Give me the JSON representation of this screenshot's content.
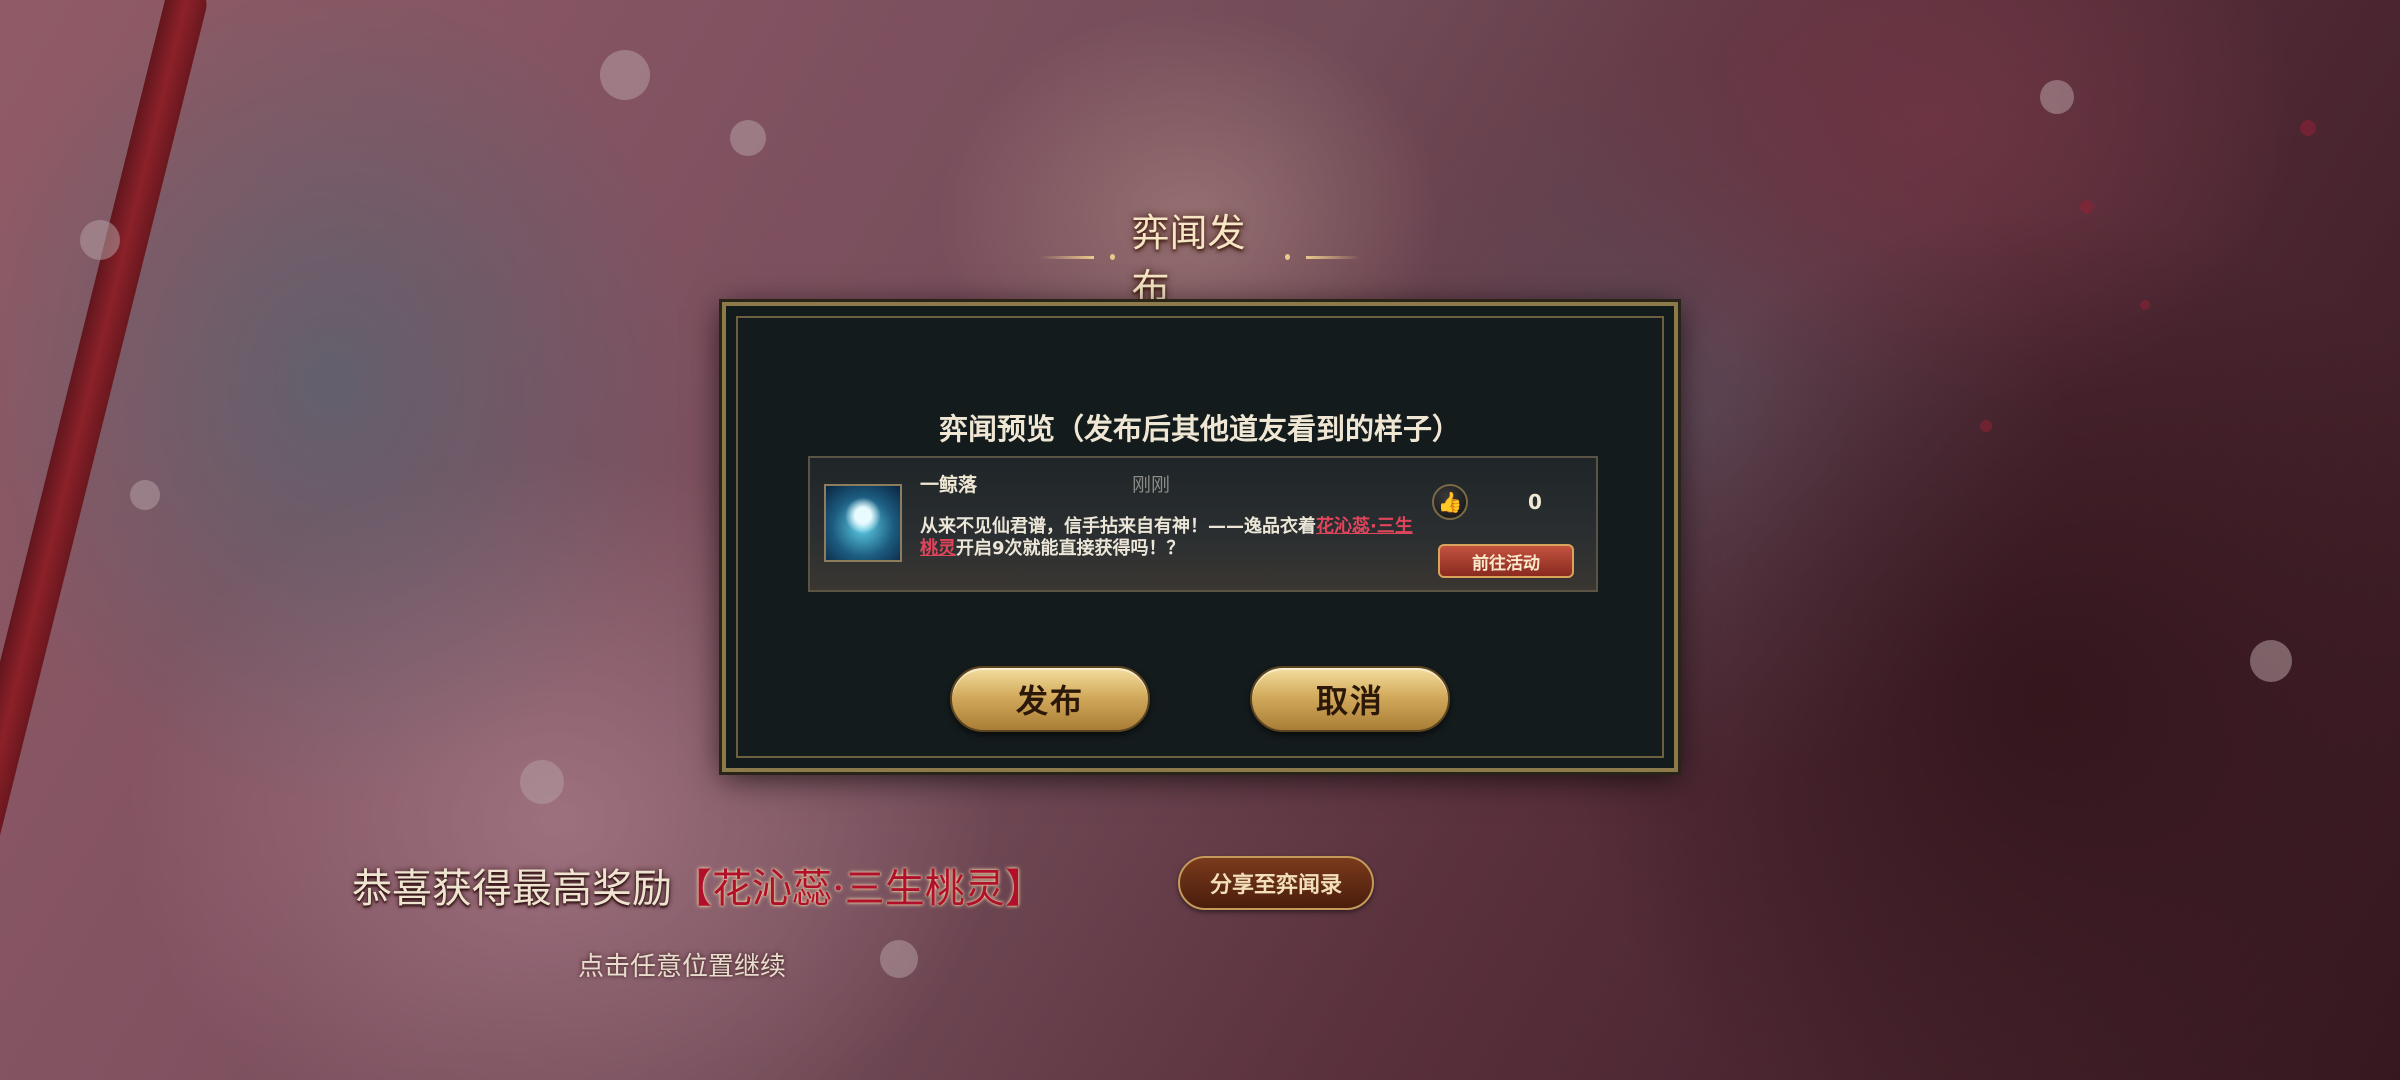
{
  "header": {
    "title": "弈闻发布"
  },
  "dialog": {
    "preview_title": "弈闻预览（发布后其他道友看到的样子）",
    "card": {
      "username": "一鲸落",
      "timestamp": "刚刚",
      "message_prefix": "从来不见仙君谱，信手拈来自有神！——逸品衣着",
      "message_highlight": "花沁蕊·三生桃灵",
      "message_suffix": "开启9次就能直接获得吗！？",
      "like_count": "0",
      "goto_button": "前往活动"
    },
    "publish_button": "发布",
    "cancel_button": "取消"
  },
  "reward": {
    "prefix": "恭喜获得最高奖励",
    "item": "【花沁蕊·三生桃灵】"
  },
  "share_button": "分享至弈闻录",
  "continue_hint": "点击任意位置继续",
  "colors": {
    "highlight": "#e0455c",
    "reward_item": "#b0102b",
    "dialog_bg": "#141b1d",
    "gold": "#d3ab5d"
  },
  "icons": [
    "thumbs-up-icon",
    "avatar-icon"
  ]
}
